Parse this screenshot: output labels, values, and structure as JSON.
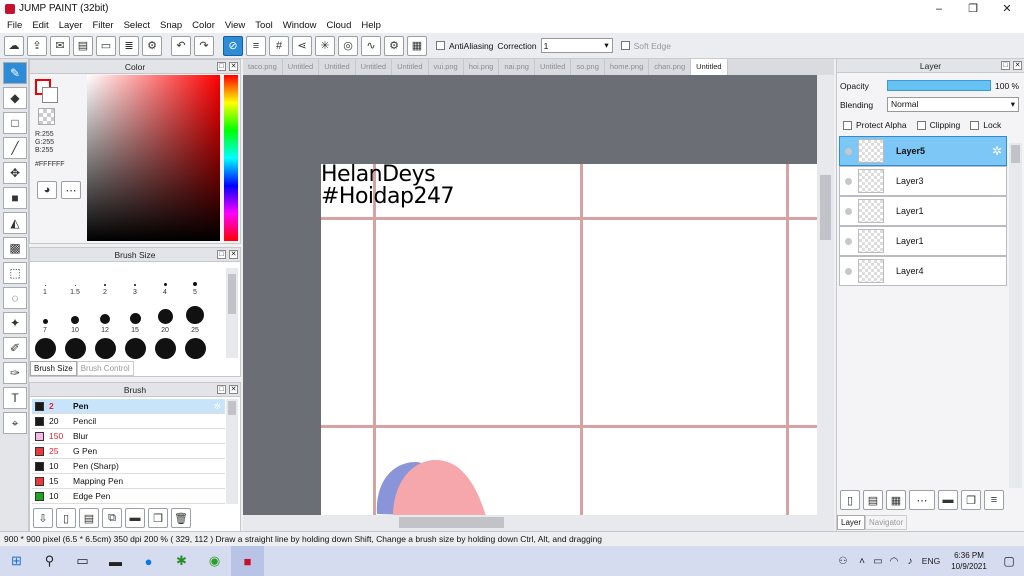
{
  "window": {
    "title": "JUMP PAINT (32bit)",
    "minimize": "–",
    "restore": "❐",
    "close": "✕"
  },
  "menu": [
    "File",
    "Edit",
    "Layer",
    "Filter",
    "Select",
    "Snap",
    "Color",
    "View",
    "Tool",
    "Window",
    "Cloud",
    "Help"
  ],
  "toolbar": {
    "antialias_label": "AntiAliasing",
    "correction_label": "Correction",
    "correction_value": "1",
    "softedge_label": "Soft Edge"
  },
  "color_panel": {
    "title": "Color",
    "r": "R:255",
    "g": "G:255",
    "b": "B:255",
    "hex": "#FFFFFF",
    "fg_color": "#ff0000",
    "bg_color": "#ffffff"
  },
  "brush_size_panel": {
    "title": "Brush Size",
    "sizes": [
      "1",
      "1.5",
      "2",
      "3",
      "4",
      "5",
      "7",
      "10",
      "12",
      "15",
      "20",
      "25",
      "",
      "",
      "",
      "",
      "",
      ""
    ],
    "tabs": [
      "Brush Size",
      "Brush Control"
    ]
  },
  "brush_panel": {
    "title": "Brush",
    "items": [
      {
        "size": "2",
        "name": "Pen",
        "color": "#1a1a1a"
      },
      {
        "size": "20",
        "name": "Pencil",
        "color": "#1a1a1a"
      },
      {
        "size": "150",
        "name": "Blur",
        "color": "#f5b8e6"
      },
      {
        "size": "25",
        "name": "G Pen",
        "color": "#e83a3a"
      },
      {
        "size": "10",
        "name": "Pen (Sharp)",
        "color": "#1a1a1a"
      },
      {
        "size": "15",
        "name": "Mapping Pen",
        "color": "#e83a3a"
      },
      {
        "size": "10",
        "name": "Edge Pen",
        "color": "#1fa81f"
      }
    ]
  },
  "tabs": [
    "taco.png",
    "Untitled",
    "Untitled",
    "Untitled",
    "Untitled",
    "vui.png",
    "hoi.png",
    "nai.png",
    "Untitled",
    "so.png",
    "home.png",
    "chan.png",
    "Untitled"
  ],
  "canvas": {
    "text_line1": "HelanDeys",
    "text_line2": "#Hoidap247"
  },
  "layer_panel": {
    "title": "Layer",
    "opacity_label": "Opacity",
    "opacity_value": "100 %",
    "blending_label": "Blending",
    "blending_value": "Normal",
    "protect_alpha": "Protect Alpha",
    "clipping": "Clipping",
    "lock": "Lock",
    "layers": [
      "Layer5",
      "Layer3",
      "Layer1",
      "Layer1",
      "Layer4"
    ],
    "bottom_tabs": [
      "Layer",
      "Navigator"
    ]
  },
  "status": "900 * 900 pixel  (6.5 * 6.5cm)  350 dpi  200 %  ( 329, 112 )  Draw a straight line by holding down Shift, Change a brush size by holding down Ctrl, Alt, and dragging",
  "taskbar": {
    "lang": "ENG",
    "time": "6:36 PM",
    "date": "10/9/2021"
  }
}
